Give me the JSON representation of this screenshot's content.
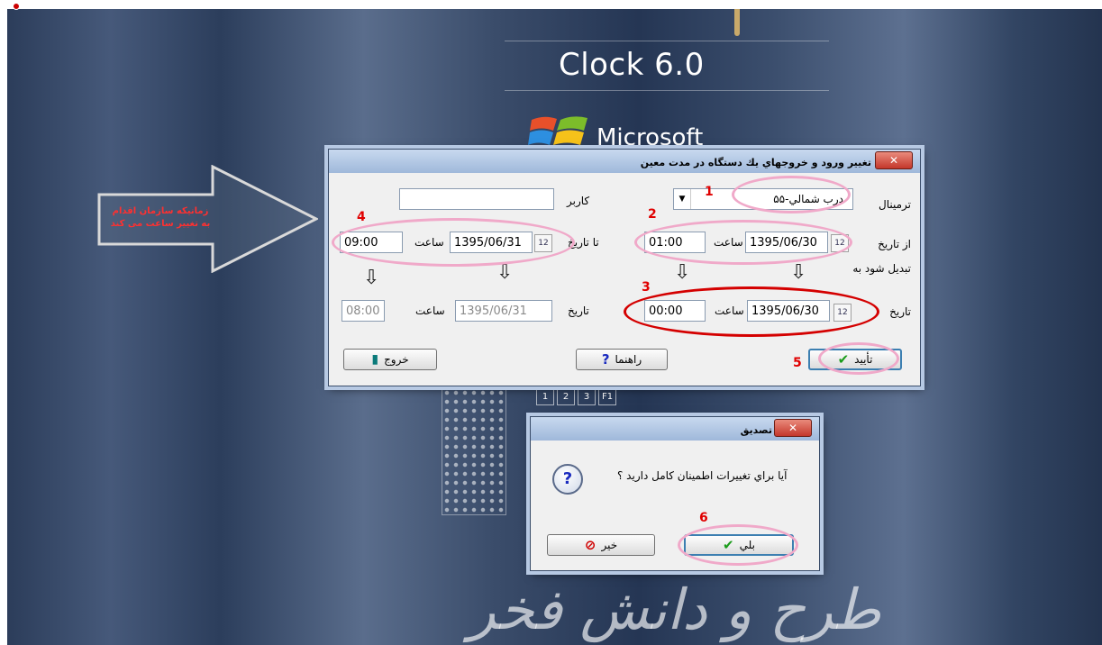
{
  "background": {
    "app_title": "Clock 6.0",
    "brand": "Microsoft",
    "keypad_keys": [
      "1",
      "2",
      "3",
      "F1"
    ],
    "calligraphy": "طرح و دانش فخر"
  },
  "annotation": {
    "arrow_text": "زمانیکه سازمان اقدام به تغییر ساعت می کند"
  },
  "main_dialog": {
    "title": "تغيير ورود و خروجهاي يك دستگاه در مدت معين",
    "close": "✕",
    "terminal_label": "ترمينال",
    "terminal_value": "۵۵-درب شمالي",
    "user_label": "كاربر",
    "user_value": "",
    "from_date_label": "از تاريخ",
    "from_date": "1395/06/30",
    "time_label": "ساعت",
    "from_time": "01:00",
    "to_date_label": "تا تاريخ",
    "to_date": "1395/06/31",
    "to_time": "09:00",
    "change_to_label": "تبديل شود به",
    "date_label": "تاريخ",
    "new_from_date": "1395/06/30",
    "new_from_time": "00:00",
    "new_to_date": "1395/06/31",
    "new_to_time": "08:00",
    "confirm_button": "تأييد",
    "help_button": "راهنما",
    "exit_button": "خروج"
  },
  "confirm_dialog": {
    "title": "تصديق",
    "close": "✕",
    "message": "آيا براي تغييرات اطمينان كامل داريد ؟",
    "yes_button": "بلي",
    "no_button": "خير"
  },
  "step_markers": [
    "1",
    "2",
    "3",
    "4",
    "5",
    "6"
  ],
  "colors": {
    "marker": "#e00000",
    "highlight": "#f0a9c9",
    "emphasis": "#d40000"
  }
}
